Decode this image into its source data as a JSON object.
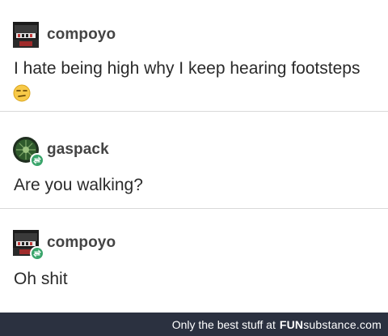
{
  "posts": [
    {
      "username": "compoyo",
      "text": "I hate being high why I keep hearing footsteps",
      "emoji": "unamused-face",
      "avatar": "compoyo-avatar",
      "reblog": false
    },
    {
      "username": "gaspack",
      "text": "Are you walking?",
      "avatar": "gaspack-avatar",
      "reblog": true
    },
    {
      "username": "compoyo",
      "text": "Oh shit",
      "avatar": "compoyo-avatar",
      "reblog": true
    }
  ],
  "footer": {
    "prefix": "Only the best stuff at",
    "brand_strong": "FUN",
    "brand_rest": "substance.com"
  },
  "colors": {
    "reblog_badge": "#3aa56b",
    "footer_bg": "#2b3140"
  }
}
